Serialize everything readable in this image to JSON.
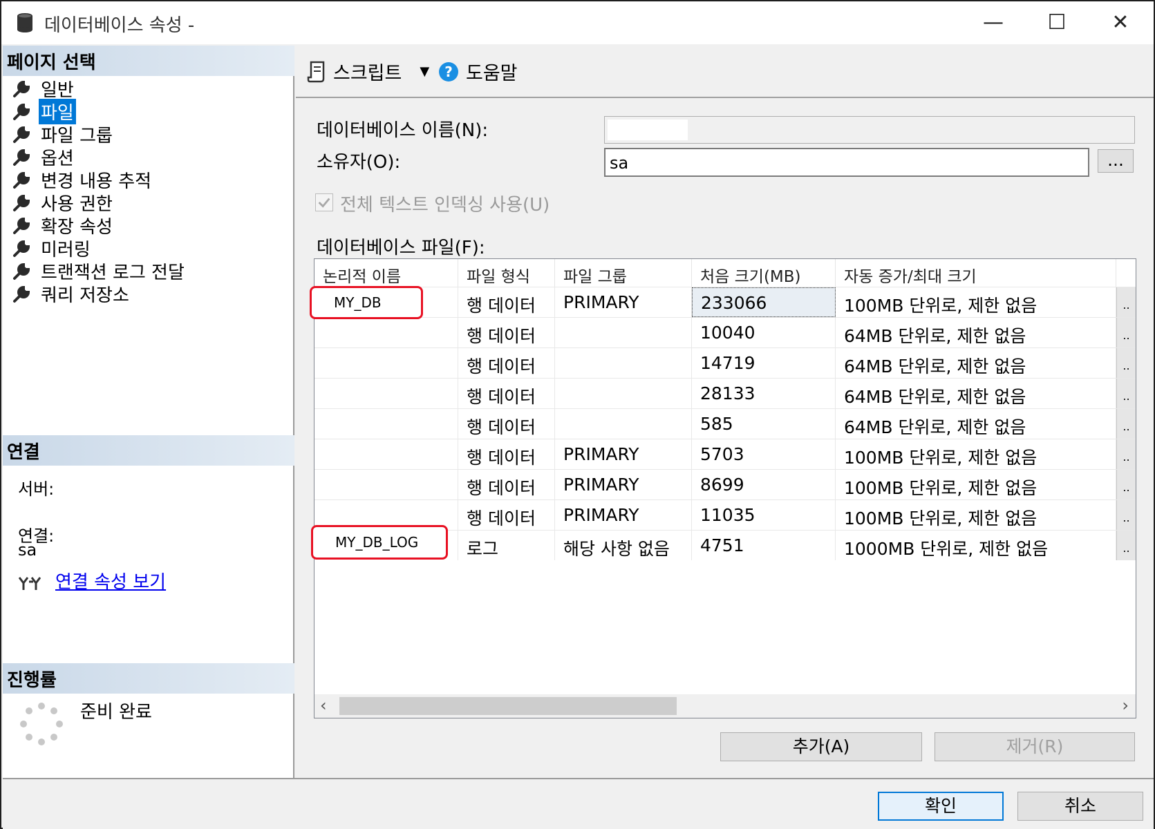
{
  "window": {
    "title": "데이터베이스 속성 -",
    "minimize": "—",
    "maximize": "☐",
    "close": "✕"
  },
  "left": {
    "page_select_header": "페이지 선택",
    "nav_items": [
      {
        "label": "일반"
      },
      {
        "label": "파일"
      },
      {
        "label": "파일 그룹"
      },
      {
        "label": "옵션"
      },
      {
        "label": "변경 내용 추적"
      },
      {
        "label": "사용 권한"
      },
      {
        "label": "확장 속성"
      },
      {
        "label": "미러링"
      },
      {
        "label": "트랜잭션 로그 전달"
      },
      {
        "label": "쿼리 저장소"
      }
    ],
    "selected_index": 1,
    "connection_header": "연결",
    "server_label": "서버:",
    "connection_label": "연결:",
    "connection_value": "sa",
    "connection_link": "연결 속성 보기",
    "progress_header": "진행률",
    "progress_status": "준비 완료"
  },
  "toolbar": {
    "script_label": "스크립트",
    "help_label": "도움말"
  },
  "form": {
    "db_name_label": "데이터베이스 이름(N):",
    "db_name_value": "",
    "owner_label": "소유자(O):",
    "owner_value": "sa",
    "owner_browse": "...",
    "fulltext_label": "전체 텍스트 인덱싱 사용(U)",
    "fulltext_checked": true,
    "files_label": "데이터베이스 파일(F):"
  },
  "grid": {
    "columns": [
      "논리적 이름",
      "파일 형식",
      "파일 그룹",
      "처음 크기(MB)",
      "자동 증가/최대 크기"
    ],
    "rows": [
      {
        "name": "MY_DB",
        "type": "행 데이터",
        "group": "PRIMARY",
        "size": "233066",
        "growth": "100MB 단위로, 제한 없음"
      },
      {
        "name": "",
        "type": "행 데이터",
        "group": "",
        "size": "10040",
        "growth": "64MB 단위로, 제한 없음"
      },
      {
        "name": "",
        "type": "행 데이터",
        "group": "",
        "size": "14719",
        "growth": "64MB 단위로, 제한 없음"
      },
      {
        "name": "",
        "type": "행 데이터",
        "group": "",
        "size": "28133",
        "growth": "64MB 단위로, 제한 없음"
      },
      {
        "name": "",
        "type": "행 데이터",
        "group": "",
        "size": "585",
        "growth": "64MB 단위로, 제한 없음"
      },
      {
        "name": "",
        "type": "행 데이터",
        "group": "PRIMARY",
        "size": "5703",
        "growth": "100MB 단위로, 제한 없음"
      },
      {
        "name": "",
        "type": "행 데이터",
        "group": "PRIMARY",
        "size": "8699",
        "growth": "100MB 단위로, 제한 없음"
      },
      {
        "name": "",
        "type": "행 데이터",
        "group": "PRIMARY",
        "size": "11035",
        "growth": "100MB 단위로, 제한 없음"
      },
      {
        "name": "MY_DB_LOG",
        "type": "로그",
        "group": "해당 사항 없음",
        "size": "4751",
        "growth": "1000MB 단위로, 제한 없음"
      }
    ],
    "ellipsis": ".."
  },
  "buttons": {
    "add": "추가(A)",
    "remove": "제거(R)",
    "ok": "확인",
    "cancel": "취소"
  },
  "colors": {
    "selection": "#0078d7",
    "highlight_box": "#e81123",
    "link": "#0000ee"
  }
}
